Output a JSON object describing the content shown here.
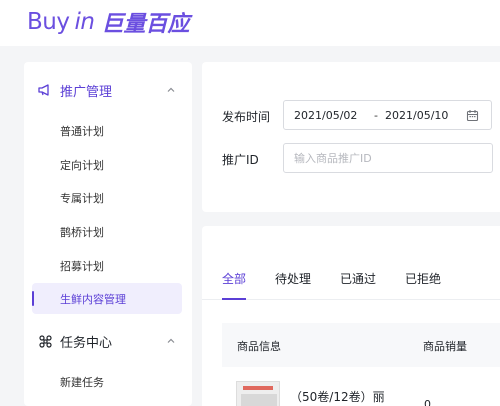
{
  "logo": {
    "en_main": "Buy",
    "en_in": "in",
    "cn": "巨量百应"
  },
  "sidebar": {
    "groups": [
      {
        "label": "推广管理",
        "items": [
          "普通计划",
          "定向计划",
          "专属计划",
          "鹊桥计划",
          "招募计划",
          "生鲜内容管理"
        ],
        "active": "生鲜内容管理"
      },
      {
        "label": "任务中心",
        "items": [
          "新建任务"
        ]
      }
    ]
  },
  "filter": {
    "date_label": "发布时间",
    "date_start": "2021/05/02",
    "date_sep": "-",
    "date_end": "2021/05/10",
    "id_label": "推广ID",
    "id_placeholder": "输入商品推广ID"
  },
  "list": {
    "tabs": [
      "全部",
      "待处理",
      "已通过",
      "已拒绝"
    ],
    "active_tab": "全部",
    "columns": [
      "商品信息",
      "商品销量"
    ],
    "rows": [
      {
        "title": "（50卷/12卷）丽",
        "sales": "0"
      }
    ]
  },
  "colors": {
    "brand": "#6b4fe0",
    "active": "#5b3fd6"
  }
}
